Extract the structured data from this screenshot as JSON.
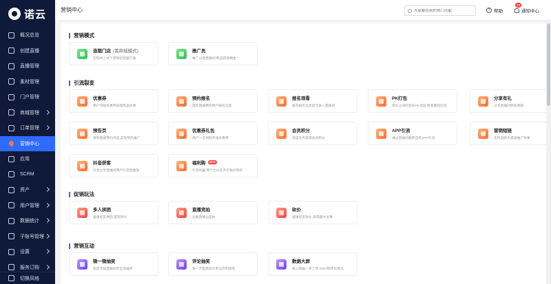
{
  "app": {
    "logo_text": "诺云"
  },
  "sidebar": {
    "items": [
      {
        "label": "概况总览",
        "icon": "dashboard-icon",
        "chevron": false,
        "active": false
      },
      {
        "label": "创建直播",
        "icon": "create-live-icon",
        "chevron": false,
        "active": false
      },
      {
        "label": "直播管理",
        "icon": "live-manage-icon",
        "chevron": false,
        "active": false
      },
      {
        "label": "素材管理",
        "icon": "material-icon",
        "chevron": false,
        "active": false
      },
      {
        "label": "门户管理",
        "icon": "portal-icon",
        "chevron": false,
        "active": false
      },
      {
        "label": "商城管理",
        "icon": "mall-icon",
        "chevron": true,
        "active": false
      },
      {
        "label": "订单管理",
        "icon": "order-icon",
        "chevron": true,
        "active": false
      },
      {
        "label": "营销中心",
        "icon": "fire-icon",
        "chevron": false,
        "active": true
      },
      {
        "label": "应用",
        "icon": "apps-icon",
        "chevron": false,
        "active": false
      },
      {
        "label": "SCRM",
        "icon": "scrm-icon",
        "chevron": false,
        "active": false
      },
      {
        "label": "资产",
        "icon": "asset-icon",
        "chevron": true,
        "active": false
      },
      {
        "label": "用户管理",
        "icon": "user-icon",
        "chevron": true,
        "active": false
      },
      {
        "label": "数据统计",
        "icon": "stats-icon",
        "chevron": true,
        "active": false
      },
      {
        "label": "子账号管理",
        "icon": "subaccount-icon",
        "chevron": true,
        "active": false
      },
      {
        "label": "设置",
        "icon": "settings-icon",
        "chevron": true,
        "active": false
      },
      {
        "label": "服务订购",
        "icon": "subscribe-icon",
        "chevron": true,
        "active": false
      }
    ],
    "bottom_label": "切换风格"
  },
  "header": {
    "title": "营销中心",
    "search_placeholder": "大家都在用的热门功能",
    "help_label": "帮助",
    "notice_label": "通知中心",
    "notice_badge": "28"
  },
  "sections": [
    {
      "title": "营销模式",
      "cards": [
        {
          "name": "连锁门店",
          "name_extra": "(需商城模式)",
          "desc": "实现线上线下营销全链路打通",
          "icon": "store-icon",
          "color": "green",
          "tag": ""
        },
        {
          "name": "推广员",
          "name_extra": "",
          "desc": "推广分销直播间/商品获得佣金",
          "icon": "promoter-icon",
          "color": "green",
          "tag": ""
        }
      ]
    },
    {
      "title": "引流裂变",
      "cards": [
        {
          "name": "优惠券",
          "name_extra": "",
          "desc": "用户领取优惠券获得商品优惠",
          "icon": "coupon-icon",
          "color": "orange",
          "tag": ""
        },
        {
          "name": "预约报名",
          "name_extra": "",
          "desc": "提前直播预热用户报名信息",
          "icon": "signup-icon",
          "color": "orange",
          "tag": ""
        },
        {
          "name": "报名观看",
          "name_extra": "",
          "desc": "填写报名信息后可进入直播间",
          "icon": "watch-signup-icon",
          "color": "orange",
          "tag": ""
        },
        {
          "name": "PK打包",
          "name_extra": "",
          "desc": "观众之间的竞技PK活动 胜者赢取红包",
          "icon": "pk-icon",
          "color": "orange",
          "tag": ""
        },
        {
          "name": "分享有礼",
          "name_extra": "",
          "desc": "分享直播间获得奖励",
          "icon": "share-gift-icon",
          "color": "orange",
          "tag": ""
        },
        {
          "name": "预告页",
          "name_extra": "",
          "desc": "录制直播预约内容,实现预热推广",
          "icon": "preview-icon",
          "color": "orange",
          "tag": ""
        },
        {
          "name": "优惠券礼包",
          "name_extra": "",
          "desc": "用户一次领取多张优惠券",
          "icon": "coupon-pack-icon",
          "color": "orange",
          "tag": ""
        },
        {
          "name": "会员积分",
          "name_extra": "",
          "desc": "完成任务获得会员积分",
          "icon": "vip-icon",
          "color": "orange",
          "tag": ""
        },
        {
          "name": "APP引流",
          "name_extra": "",
          "desc": "通过直播间跳转自有APP引流",
          "icon": "app-icon",
          "color": "orange",
          "tag": ""
        },
        {
          "name": "营销短链",
          "name_extra": "",
          "desc": "实时追踪多渠道推广效果",
          "icon": "shortlink-icon",
          "color": "orange",
          "tag": ""
        },
        {
          "name": "抖音获客",
          "name_extra": "",
          "desc": "抖音分享直播间用户引流回播放",
          "icon": "douyin-icon",
          "color": "orange",
          "tag": ""
        },
        {
          "name": "福利购",
          "name_extra": "",
          "desc": "引流利器,用户出分任务可低价购买",
          "icon": "welfare-icon",
          "color": "orange",
          "tag": "NEW"
        }
      ]
    },
    {
      "title": "促销玩法",
      "cards": [
        {
          "name": "多人拼团",
          "name_extra": "",
          "desc": "邀请好友拼团,提高转化",
          "icon": "group-buy-icon",
          "color": "red",
          "tag": ""
        },
        {
          "name": "直播竞拍",
          "name_extra": "",
          "desc": "边看直播边竞拍",
          "icon": "auction-icon",
          "color": "red",
          "tag": ""
        },
        {
          "name": "砍价",
          "name_extra": "",
          "desc": "邀请好友砍价,获得最大优惠",
          "icon": "bargain-icon",
          "color": "red",
          "tag": ""
        }
      ]
    },
    {
      "title": "营销互动",
      "cards": [
        {
          "name": "微一微抽奖",
          "name_extra": "",
          "desc": "指定活动直播间的互动抽奖",
          "icon": "lottery-icon",
          "color": "purple",
          "tag": ""
        },
        {
          "name": "评论抽奖",
          "name_extra": "",
          "desc": "进一步提高观众参与的积极性",
          "icon": "comment-lottery-icon",
          "color": "purple",
          "tag": ""
        },
        {
          "name": "数据大屏",
          "name_extra": "",
          "desc": "核心数据一目了然,GMV和转化情况",
          "icon": "data-screen-icon",
          "color": "purple",
          "tag": ""
        }
      ]
    }
  ]
}
